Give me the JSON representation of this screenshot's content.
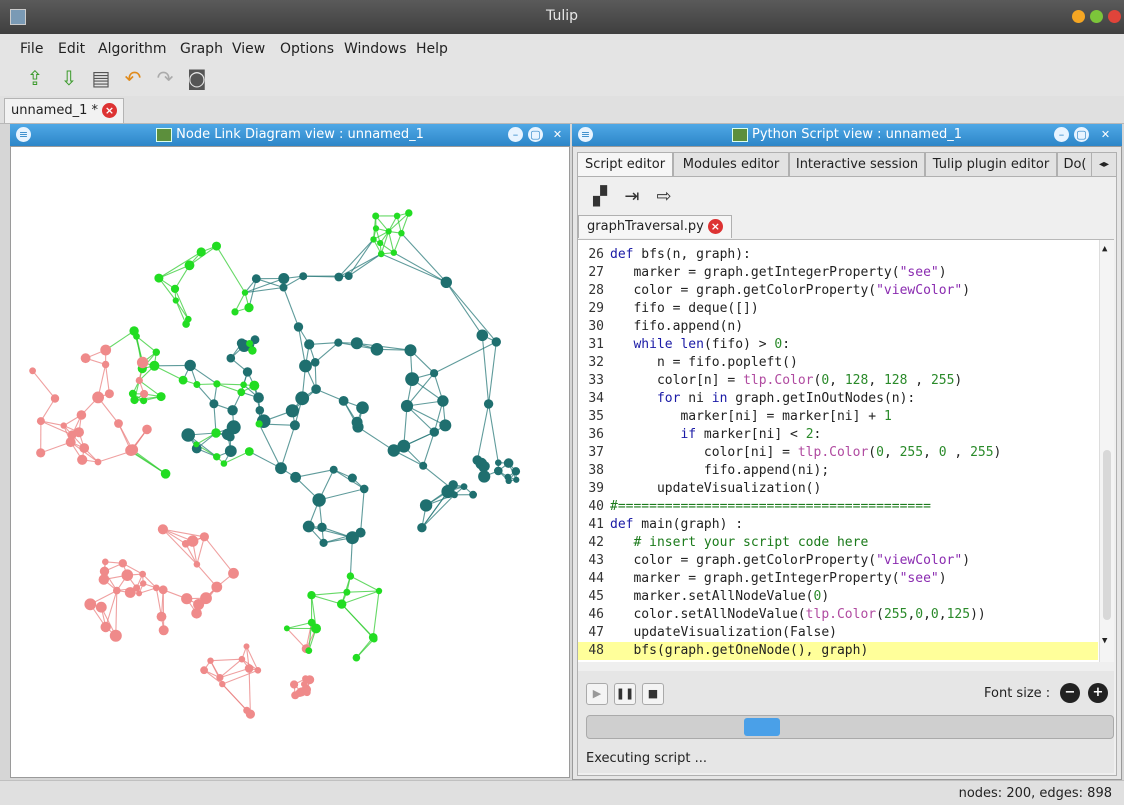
{
  "window": {
    "title": "Tulip"
  },
  "menu": [
    "File",
    "Edit",
    "Algorithm",
    "Graph",
    "View",
    "Options",
    "Windows",
    "Help"
  ],
  "doc_tab": {
    "label": "unnamed_1 *"
  },
  "left_panel": {
    "title": "Node Link Diagram view : unnamed_1"
  },
  "right_panel": {
    "title": "Python Script view : unnamed_1",
    "tabs": [
      "Script editor",
      "Modules editor",
      "Interactive session",
      "Tulip plugin editor",
      "Do("
    ],
    "file_tab": "graphTraversal.py",
    "code": [
      {
        "n": "26",
        "t": "def bfs(n, graph):"
      },
      {
        "n": "27",
        "t": "   marker = graph.getIntegerProperty(\"see\")"
      },
      {
        "n": "28",
        "t": "   color = graph.getColorProperty(\"viewColor\")"
      },
      {
        "n": "29",
        "t": "   fifo = deque([])"
      },
      {
        "n": "30",
        "t": "   fifo.append(n)"
      },
      {
        "n": "31",
        "t": "   while len(fifo) > 0:"
      },
      {
        "n": "32",
        "t": "      n = fifo.popleft()"
      },
      {
        "n": "33",
        "t": "      color[n] = tlp.Color(0, 128, 128 , 255)"
      },
      {
        "n": "34",
        "t": "      for ni in graph.getInOutNodes(n):"
      },
      {
        "n": "35",
        "t": "         marker[ni] = marker[ni] + 1"
      },
      {
        "n": "36",
        "t": "         if marker[ni] < 2:"
      },
      {
        "n": "37",
        "t": "            color[ni] = tlp.Color(0, 255, 0 , 255)"
      },
      {
        "n": "38",
        "t": "            fifo.append(ni);"
      },
      {
        "n": "39",
        "t": "      updateVisualization()"
      },
      {
        "n": "40",
        "t": "#========================================"
      },
      {
        "n": "41",
        "t": "def main(graph) :"
      },
      {
        "n": "42",
        "t": "   # insert your script code here"
      },
      {
        "n": "43",
        "t": "   color = graph.getColorProperty(\"viewColor\")"
      },
      {
        "n": "44",
        "t": "   marker = graph.getIntegerProperty(\"see\")"
      },
      {
        "n": "45",
        "t": "   marker.setAllNodeValue(0)"
      },
      {
        "n": "46",
        "t": "   color.setAllNodeValue(tlp.Color(255,0,0,125))"
      },
      {
        "n": "47",
        "t": "   updateVisualization(False)"
      },
      {
        "n": "48",
        "t": "   bfs(graph.getOneNode(), graph)"
      }
    ],
    "font_size_label": "Font size :",
    "status": "Executing script ...",
    "progress": 0.32
  },
  "statusbar": {
    "text": "nodes: 200, edges: 898"
  },
  "colors": {
    "title_bar": "#2d86c8",
    "node_teal": "#1f6f6f",
    "node_green": "#22dd22",
    "node_pink": "#ef8a8a",
    "highlight": "#ffff9a"
  }
}
